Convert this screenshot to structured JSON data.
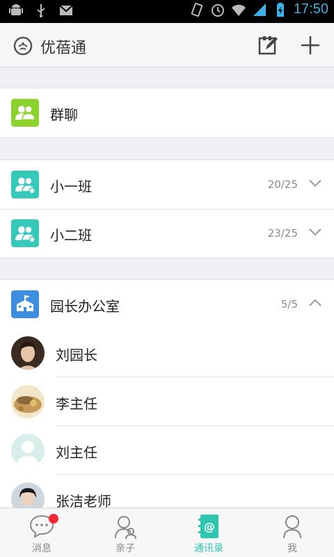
{
  "status_bar": {
    "time": "17:50",
    "icons": [
      "android-icon",
      "usb-icon",
      "gmail-icon",
      "rotate-icon",
      "alarm-icon",
      "wifi-icon",
      "signal-icon",
      "battery-icon"
    ]
  },
  "header": {
    "title": "优蓓通",
    "icons": [
      "logo-icon",
      "compose-icon",
      "plus-icon"
    ]
  },
  "sections": {
    "group_chat": {
      "label": "群聊"
    },
    "classes": [
      {
        "label": "小一班",
        "count": "20/25",
        "expanded": false
      },
      {
        "label": "小二班",
        "count": "23/25",
        "expanded": false
      }
    ],
    "office": {
      "label": "园长办公室",
      "count": "5/5",
      "expanded": true
    },
    "members": [
      {
        "name": "刘园长",
        "avatar": "photo-woman"
      },
      {
        "name": "李主任",
        "avatar": "photo-food"
      },
      {
        "name": "刘主任",
        "avatar": "default-avatar"
      },
      {
        "name": "张洁老师",
        "avatar": "photo-woman-2"
      }
    ]
  },
  "tabs": [
    {
      "label": "消息",
      "icon": "message-icon",
      "active": false,
      "badge": true
    },
    {
      "label": "亲子",
      "icon": "family-icon",
      "active": false,
      "badge": false
    },
    {
      "label": "通讯录",
      "icon": "contacts-icon",
      "active": true,
      "badge": false
    },
    {
      "label": "我",
      "icon": "me-icon",
      "active": false,
      "badge": false
    }
  ],
  "colors": {
    "green": "#8cd22d",
    "teal": "#34c9b9",
    "blue": "#3d8ee0",
    "active_tab": "#2fc6b0",
    "badge": "#f3293a",
    "status_time": "#3bb3e8"
  }
}
